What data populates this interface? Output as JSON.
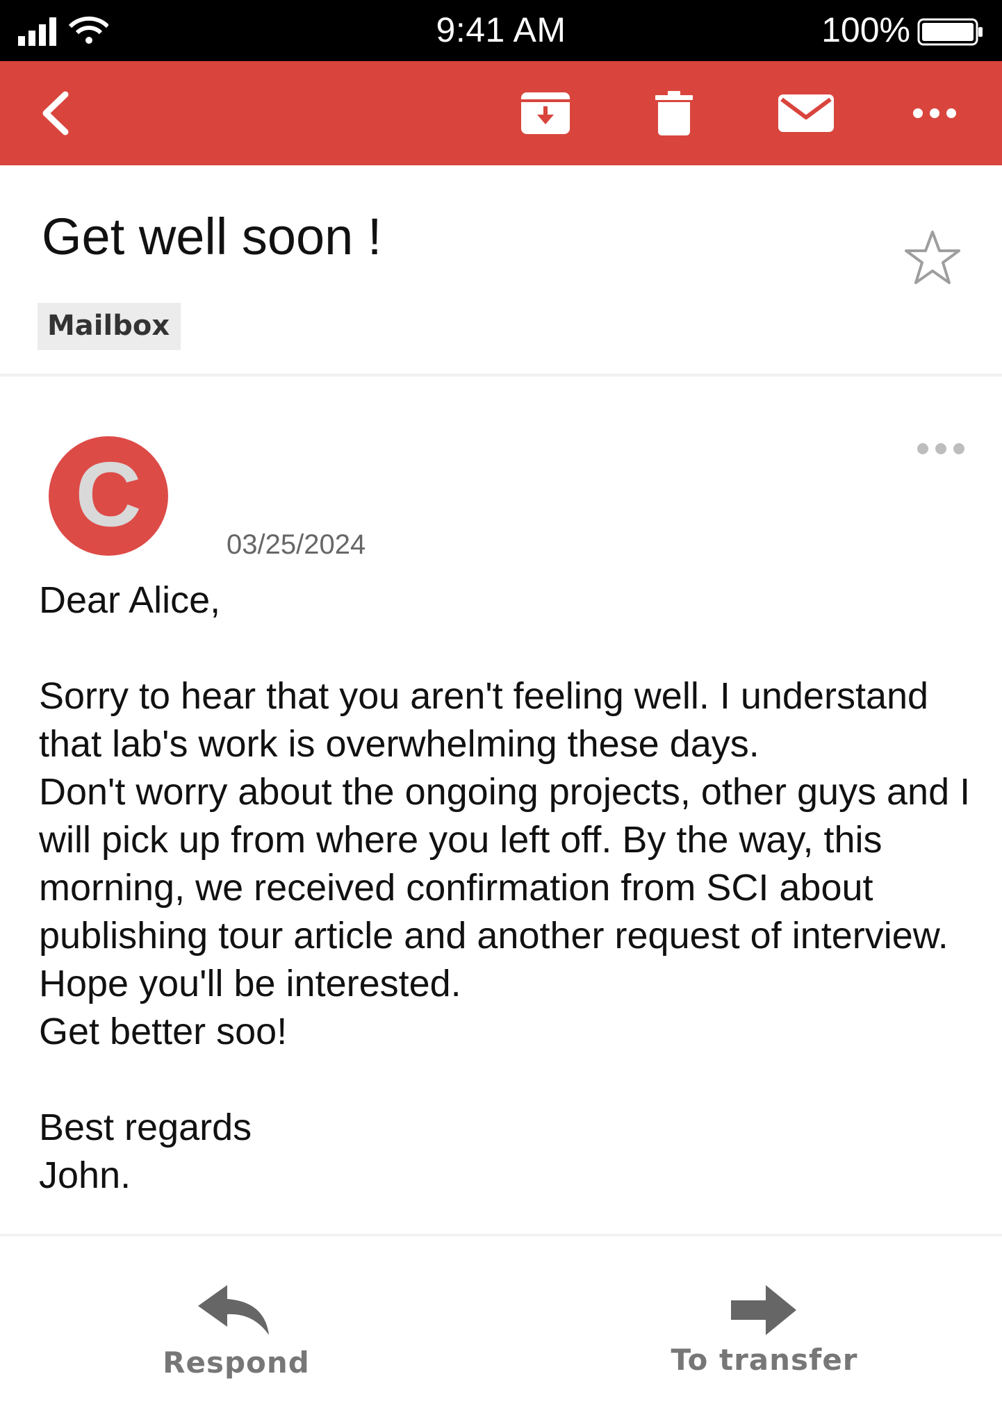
{
  "status_bar": {
    "time": "9:41 AM",
    "battery_percent": "100%",
    "icons": [
      "signal-icon",
      "wifi-icon",
      "battery-icon"
    ]
  },
  "toolbar": {
    "background": "#d9453d",
    "buttons": [
      "back-icon",
      "archive-icon",
      "trash-icon",
      "mail-icon",
      "more-icon"
    ]
  },
  "email": {
    "subject": "Get well soon !",
    "label": "Mailbox",
    "avatar_letter": "C",
    "avatar_color": "#dd4b47",
    "date": "03/25/2024",
    "body": {
      "greeting": "Dear Alice,",
      "paragraph": [
        "Sorry to hear that you aren't feeling well. I understand that lab's work is overwhelming these days.",
        "Don't worry about the ongoing projects, other guys and I will pick up from where you left off. By the way, this morning, we received confirmation from SCI about publishing tour article and another request of interview.",
        "Hope you'll be interested.",
        "Get better soo!"
      ],
      "closing": "Best regards",
      "signature": "John."
    }
  },
  "footer": {
    "respond_label": "Respond",
    "transfer_label": "To transfer"
  }
}
